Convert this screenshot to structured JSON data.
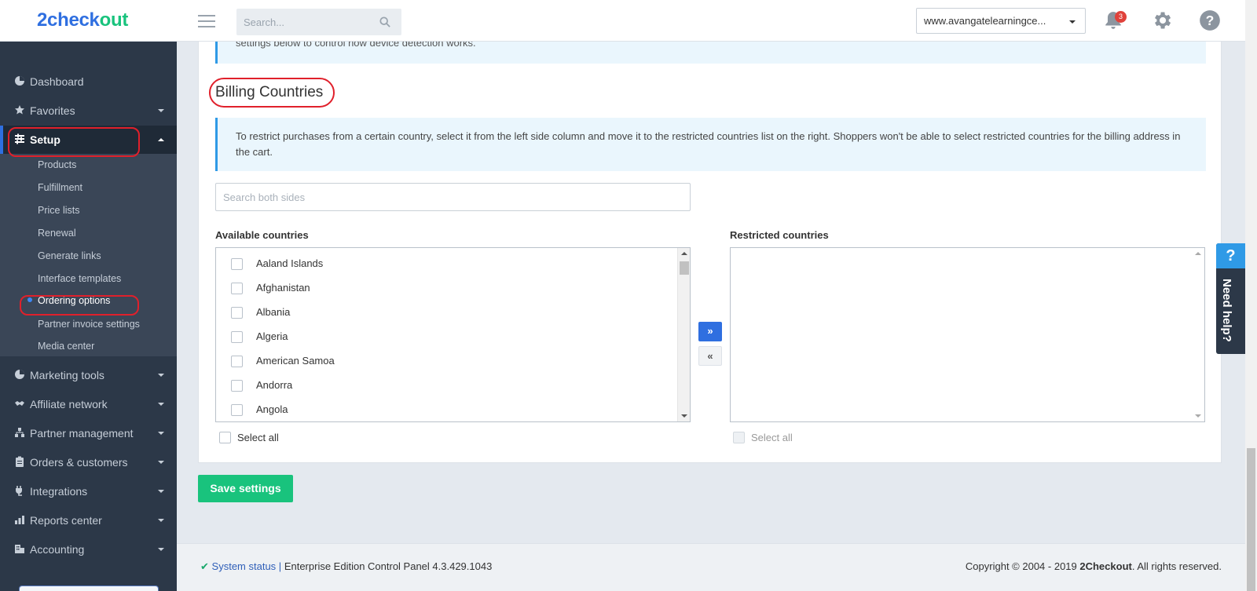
{
  "header": {
    "logo_part1": "2check",
    "logo_part2": "out",
    "search_placeholder": "Search...",
    "domain_selected": "www.avangatelearningce...",
    "notifications_count": "3"
  },
  "sidebar": {
    "items": [
      {
        "label": "Dashboard",
        "icon": "dashboard-icon"
      },
      {
        "label": "Favorites",
        "icon": "star-icon"
      },
      {
        "label": "Setup",
        "icon": "sliders-icon"
      },
      {
        "label": "Marketing tools",
        "icon": "pie-chart-icon"
      },
      {
        "label": "Affiliate network",
        "icon": "handshake-icon"
      },
      {
        "label": "Partner management",
        "icon": "sitemap-icon"
      },
      {
        "label": "Orders & customers",
        "icon": "clipboard-icon"
      },
      {
        "label": "Integrations",
        "icon": "plug-icon"
      },
      {
        "label": "Reports center",
        "icon": "bar-chart-icon"
      },
      {
        "label": "Accounting",
        "icon": "building-icon"
      }
    ],
    "setup_submenu": [
      "Products",
      "Fulfillment",
      "Price lists",
      "Renewal",
      "Generate links",
      "Interface templates",
      "Ordering options",
      "Partner invoice settings",
      "Media center"
    ]
  },
  "content": {
    "top_info_text": "settings below to control how device detection works.",
    "section_title": "Billing Countries",
    "info_text": "To restrict purchases from a certain country, select it from the left side column and move it to the restricted countries list on the right. Shoppers won't be able to select restricted countries for the billing address in the cart.",
    "search_placeholder": "Search both sides",
    "available_label": "Available countries",
    "restricted_label": "Restricted countries",
    "available_countries": [
      "Aaland Islands",
      "Afghanistan",
      "Albania",
      "Algeria",
      "American Samoa",
      "Andorra",
      "Angola"
    ],
    "move_right": "»",
    "move_left": "«",
    "select_all": "Select all",
    "save_button": "Save settings"
  },
  "footer": {
    "system_status": "System status",
    "separator": "|",
    "version_text": "Enterprise Edition Control Panel 4.3.429.1043",
    "copyright_prefix": "Copyright © 2004 - 2019 ",
    "copyright_brand": "2Checkout",
    "copyright_suffix": ". All rights reserved."
  },
  "help_tab": {
    "icon_text": "?",
    "label": "Need help?"
  },
  "colors": {
    "brand_blue": "#2f6fe0",
    "brand_green": "#19c37d",
    "sidebar_bg": "#2c3848",
    "info_accent": "#2f9ae6",
    "highlight_ring": "#e0202b"
  }
}
